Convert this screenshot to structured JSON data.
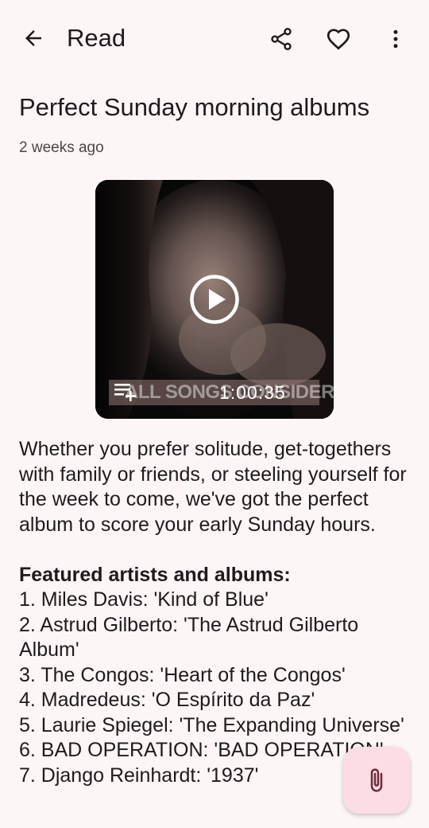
{
  "topbar": {
    "title": "Read",
    "icons": {
      "back": "arrow-back-icon",
      "share": "share-icon",
      "favorite": "heart-outline-icon",
      "more": "more-vert-icon"
    }
  },
  "article": {
    "title": "Perfect Sunday morning albums",
    "timestamp": "2 weeks ago",
    "video": {
      "caption": "ALL SONGS CONSIDERED",
      "duration": "1:00:35",
      "play_icon": "play-circle-icon",
      "queue_icon": "playlist-add-icon"
    },
    "intro": "Whether you prefer solitude, get-togethers with family or friends, or steeling yourself for the week to come, we've got the perfect album to score your early Sunday hours.",
    "featured_heading": "Featured artists and albums:",
    "albums": [
      "1. Miles Davis: 'Kind of Blue'",
      "2. Astrud Gilberto: 'The Astrud Gilberto Album'",
      "3. The Congos: 'Heart of the Congos'",
      "4. Madredeus: 'O Espírito da Paz'",
      "5. Laurie Spiegel: 'The Expanding Universe'",
      "6. BAD OPERATION: 'BAD OPERATION'",
      "7. Django Reinhardt: '1937'"
    ]
  },
  "fab": {
    "icon": "paperclip-icon",
    "color": "#fcdde3"
  },
  "colors": {
    "background": "#fcf6f6",
    "text": "#1f1a1b",
    "secondary_text": "#524446"
  }
}
